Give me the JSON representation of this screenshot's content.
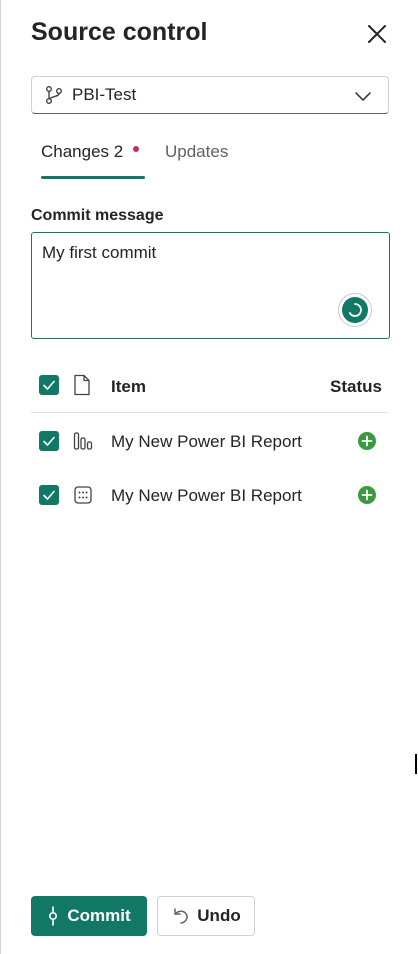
{
  "panel": {
    "title": "Source control"
  },
  "branch": {
    "name": "PBI-Test",
    "icon": "branch-icon"
  },
  "tabs": [
    {
      "label": "Changes 2",
      "active": true,
      "has_indicator": true
    },
    {
      "label": "Updates",
      "active": false
    }
  ],
  "commit": {
    "label": "Commit message",
    "value": "My first commit"
  },
  "list": {
    "header_item": "Item",
    "header_status": "Status",
    "rows": [
      {
        "label": "My New Power BI Report",
        "type_icon": "report-icon",
        "status_icon": "added-icon",
        "checked": true
      },
      {
        "label": "My New Power BI Report",
        "type_icon": "semantic-model-icon",
        "status_icon": "added-icon",
        "checked": true
      }
    ]
  },
  "footer": {
    "commit_label": "Commit",
    "undo_label": "Undo"
  },
  "colors": {
    "accent": "#117865",
    "added": "#3a9a3f",
    "indicator": "#c4314b"
  }
}
